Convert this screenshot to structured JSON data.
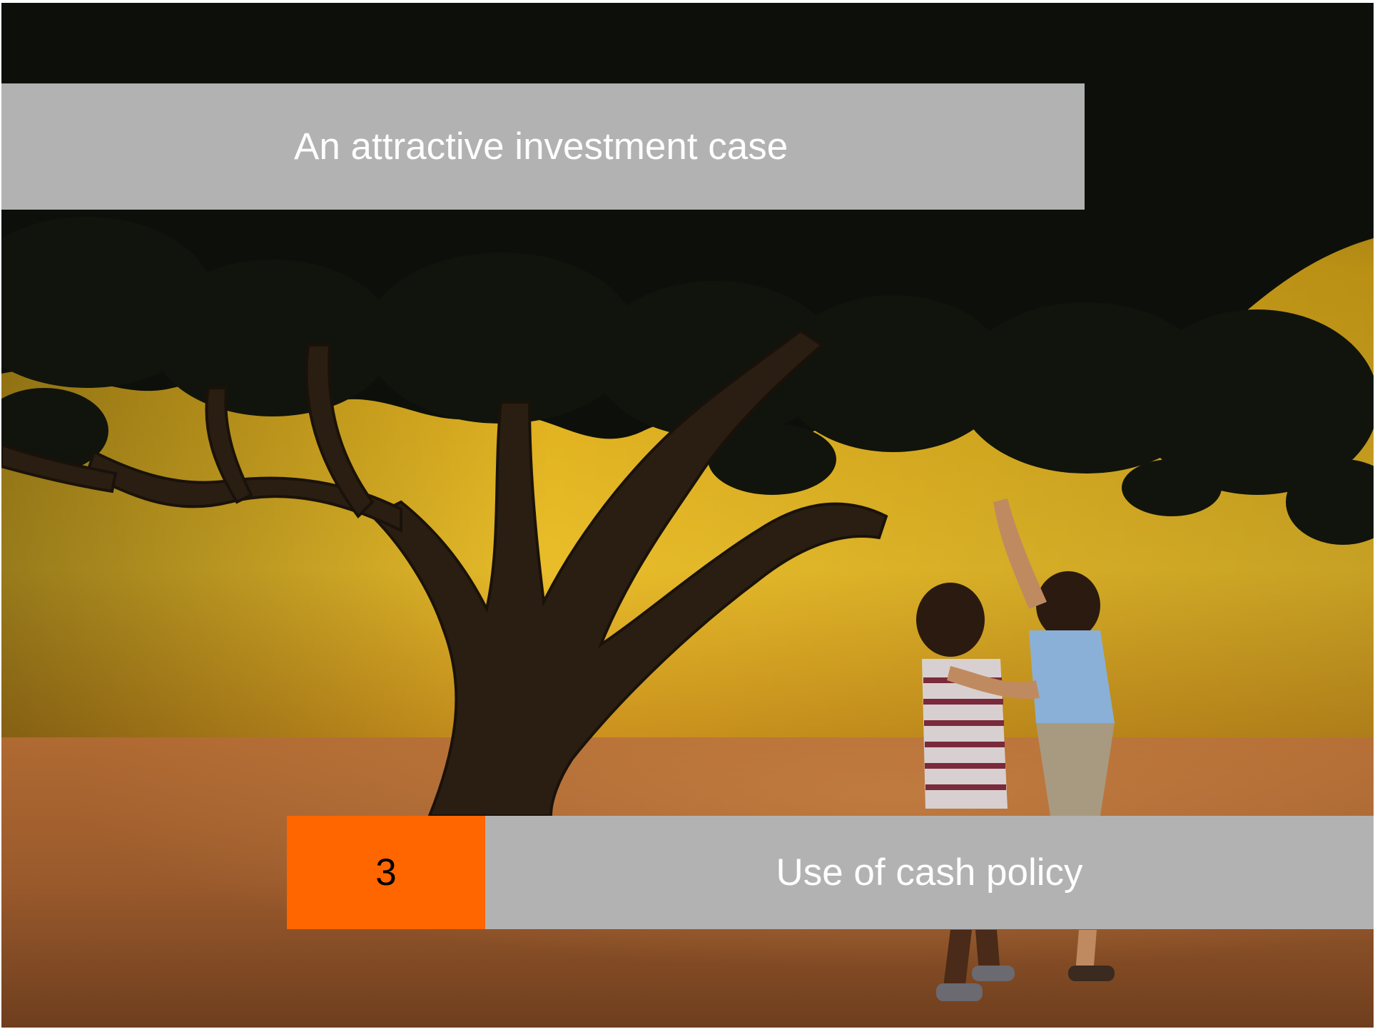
{
  "slide": {
    "title": "An attractive investment case",
    "section_number": "3",
    "section_title": "Use of cash policy"
  },
  "background_photo": {
    "subject": "two children reaching up toward a large tree against a yellow wall",
    "colors": {
      "sky_dark": "#0b0f08",
      "wall_yellow": "#e8b820",
      "ground": "#b86a32",
      "foliage": "#14160e"
    }
  },
  "colors": {
    "title_bar": "#b2b2b2",
    "accent_orange": "#ff6600",
    "title_text": "#ffffff",
    "number_text": "#000000"
  }
}
